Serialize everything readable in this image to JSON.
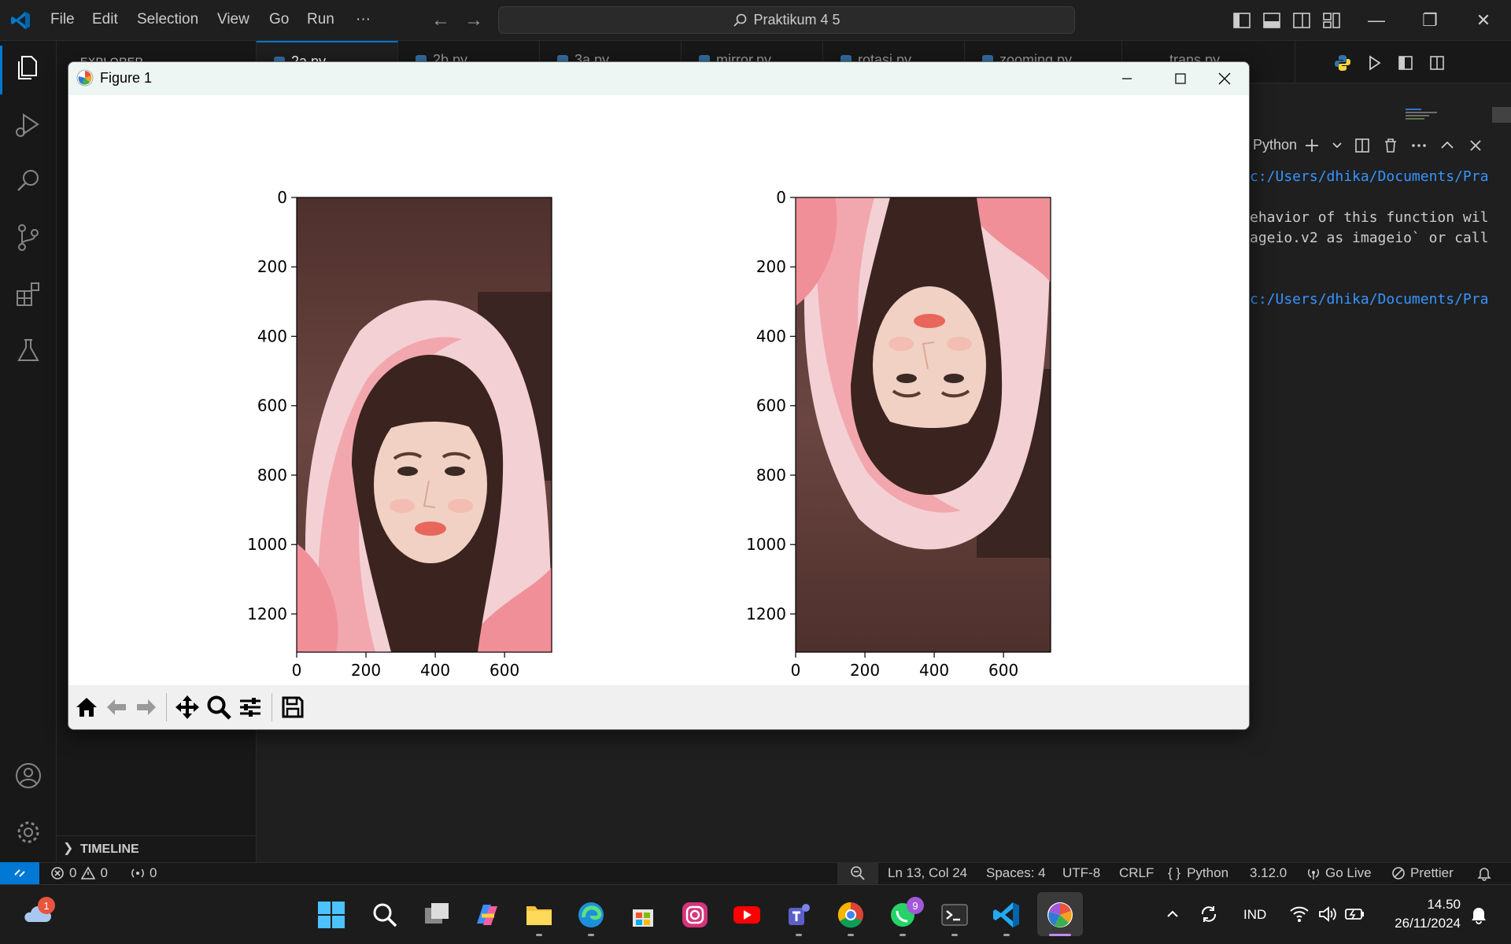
{
  "titlebar": {
    "menu": [
      "File",
      "Edit",
      "Selection",
      "View",
      "Go",
      "Run",
      "···"
    ],
    "search_text": "Praktikum 4 5"
  },
  "sidebar": {
    "title": "EXPLORER",
    "timeline_label": "TIMELINE"
  },
  "tabs": [
    {
      "label": "2a.py",
      "active": true
    },
    {
      "label": "2b.py",
      "active": false
    },
    {
      "label": "3a.py",
      "active": false
    },
    {
      "label": "mirror.py",
      "active": false
    },
    {
      "label": "rotasi.py",
      "active": false
    },
    {
      "label": "zooming.py",
      "active": false
    },
    {
      "label": "trans.py",
      "active": false
    }
  ],
  "terminal": {
    "shell_label": "Python",
    "lines": [
      {
        "text": "c:/Users/dhika/Documents/Pra",
        "kind": "path"
      },
      {
        "text": "",
        "kind": "warn"
      },
      {
        "text": "ehavior of this function wil",
        "kind": "warn"
      },
      {
        "text": "ageio.v2 as imageio` or call",
        "kind": "warn"
      },
      {
        "text": "",
        "kind": "warn"
      },
      {
        "text": "",
        "kind": "warn"
      },
      {
        "text": "c:/Users/dhika/Documents/Pra",
        "kind": "path"
      }
    ]
  },
  "figure": {
    "title": "Figure 1",
    "subplots": [
      {
        "image": "photo of a person in a pink hooded blanket, upright",
        "x_ticks": [
          "0",
          "200",
          "400",
          "600"
        ],
        "y_ticks": [
          "0",
          "200",
          "400",
          "600",
          "800",
          "1000",
          "1200"
        ],
        "flipped": false
      },
      {
        "image": "same photo flipped vertically",
        "x_ticks": [
          "0",
          "200",
          "400",
          "600"
        ],
        "y_ticks": [
          "0",
          "200",
          "400",
          "600",
          "800",
          "1000",
          "1200"
        ],
        "flipped": true
      }
    ],
    "toolbar_icons": [
      "home-icon",
      "back-arrow-icon",
      "forward-arrow-icon",
      "pan-icon",
      "zoom-icon",
      "configure-subplots-icon",
      "save-icon"
    ]
  },
  "statusbar": {
    "errors": "0",
    "warnings": "0",
    "ports": "0",
    "position": "Ln 13, Col 24",
    "spaces": "Spaces: 4",
    "encoding": "UTF-8",
    "eol": "CRLF",
    "language": "Python",
    "python_version": "3.12.0",
    "go_live": "Go Live",
    "prettier": "Prettier"
  },
  "taskbar": {
    "weather_badge": "1",
    "whatsapp_badge": "9",
    "language": "IND",
    "time": "14.50",
    "date": "26/11/2024"
  },
  "colors": {
    "accent": "#0078d4",
    "editor_bg": "#1f1f1f",
    "sidebar_bg": "#181818",
    "terminal_path": "#3794ff"
  }
}
